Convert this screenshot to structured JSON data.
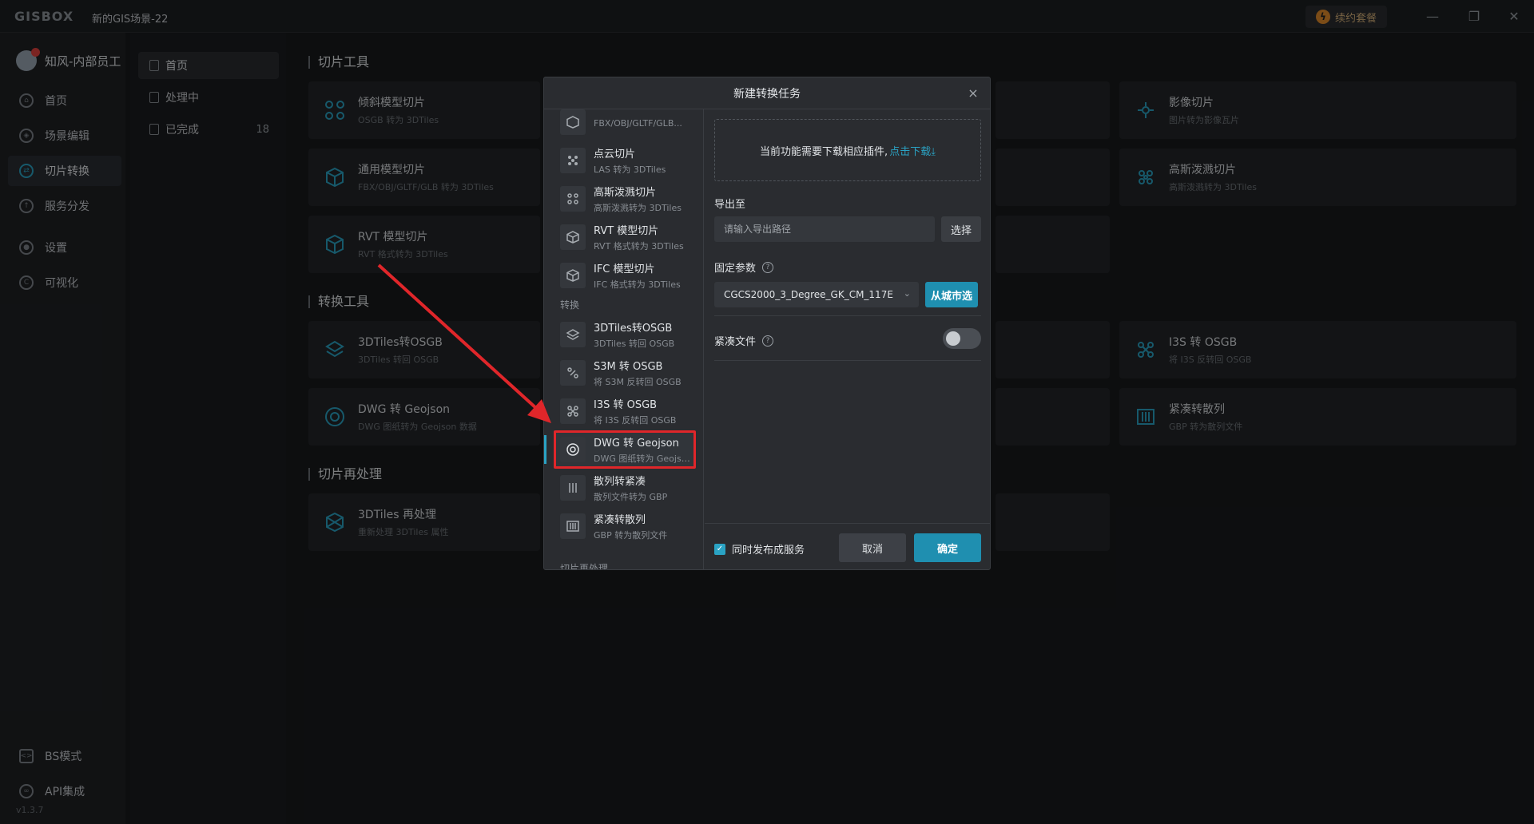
{
  "titlebar": {
    "logo": "GISBOX",
    "scene_name": "新的GIS场景-22",
    "renew_label": "续约套餐",
    "min": "—",
    "restore": "❐",
    "close": "✕"
  },
  "user": {
    "name": "知风-内部员工"
  },
  "leftnav": {
    "items": [
      {
        "label": "首页"
      },
      {
        "label": "场景编辑"
      },
      {
        "label": "切片转换"
      },
      {
        "label": "服务分发"
      },
      {
        "label": "设置"
      },
      {
        "label": "可视化"
      }
    ],
    "bottom": [
      {
        "label": "BS模式"
      },
      {
        "label": "API集成"
      }
    ],
    "version": "v1.3.7"
  },
  "subnav": {
    "items": [
      {
        "label": "首页"
      },
      {
        "label": "处理中"
      },
      {
        "label": "已完成",
        "count": "18"
      }
    ]
  },
  "sections": {
    "slice_tools": "切片工具",
    "convert_tools": "转换工具",
    "reprocess": "切片再处理"
  },
  "cards": [
    {
      "title": "倾斜模型切片",
      "sub": "OSGB 转为 3DTiles"
    },
    {
      "title": "通用模型切片",
      "sub": "FBX/OBJ/GLTF/GLB 转为 3DTiles"
    },
    {
      "title": "RVT 模型切片",
      "sub": "RVT 格式转为 3DTiles"
    },
    {
      "title": "影像切片",
      "sub": "图片转为影像瓦片"
    },
    {
      "title": "高斯泼溅切片",
      "sub": "高斯泼溅转为 3DTiles"
    },
    {
      "title": "3DTiles转OSGB",
      "sub": "3DTiles 转回 OSGB"
    },
    {
      "title": "DWG 转 Geojson",
      "sub": "DWG 图纸转为 Geojson 数据"
    },
    {
      "title": "I3S 转 OSGB",
      "sub": "将 I3S 反转回 OSGB"
    },
    {
      "title": "紧凑转散列",
      "sub": "GBP 转为散列文件"
    },
    {
      "title": "3DTiles 再处理",
      "sub": "重新处理 3DTiles 属性"
    }
  ],
  "modal": {
    "title": "新建转换任务",
    "close": "×",
    "list": [
      {
        "title": "",
        "sub": "FBX/OBJ/GLTF/GLB..."
      },
      {
        "title": "点云切片",
        "sub": "LAS 转为 3DTiles"
      },
      {
        "title": "高斯泼溅切片",
        "sub": "高斯泼溅转为 3DTiles"
      },
      {
        "title": "RVT 模型切片",
        "sub": "RVT 格式转为 3DTiles"
      },
      {
        "title": "IFC 模型切片",
        "sub": "IFC 格式转为 3DTiles"
      },
      {
        "title": "3DTiles转OSGB",
        "sub": "3DTiles 转回 OSGB"
      },
      {
        "title": "S3M 转 OSGB",
        "sub": "将 S3M 反转回 OSGB"
      },
      {
        "title": "I3S 转 OSGB",
        "sub": "将 I3S 反转回 OSGB"
      },
      {
        "title": "DWG 转 Geojson",
        "sub": "DWG 图纸转为 Geojson..."
      },
      {
        "title": "散列转紧凑",
        "sub": "散列文件转为 GBP"
      },
      {
        "title": "紧凑转散列",
        "sub": "GBP 转为散列文件"
      }
    ],
    "group_convert": "转换",
    "group_reprocess": "切片再处理",
    "plugin_notice": "当前功能需要下载相应插件,",
    "plugin_link": "点击下载⤓",
    "export_label": "导出至",
    "export_placeholder": "请输入导出路径",
    "select_btn": "选择",
    "params_label": "固定参数",
    "crs_value": "CGCS2000_3_Degree_GK_CM_117E",
    "city_btn": "从城市选",
    "compact_label": "紧凑文件",
    "publish_label": "同时发布成服务",
    "cancel": "取消",
    "ok": "确定"
  }
}
